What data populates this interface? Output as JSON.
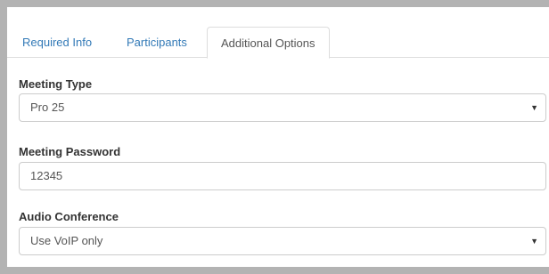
{
  "tabs": [
    {
      "label": "Required Info",
      "active": false
    },
    {
      "label": "Participants",
      "active": false
    },
    {
      "label": "Additional Options",
      "active": true
    }
  ],
  "fields": {
    "meeting_type": {
      "label": "Meeting Type",
      "value": "Pro 25"
    },
    "meeting_password": {
      "label": "Meeting Password",
      "value": "12345"
    },
    "audio_conference": {
      "label": "Audio Conference",
      "value": "Use VoIP only"
    }
  },
  "icons": {
    "dropdown": "chevron-down-icon"
  },
  "colors": {
    "link": "#337ab7",
    "background": "#b3b3b3",
    "panel": "#ffffff"
  }
}
